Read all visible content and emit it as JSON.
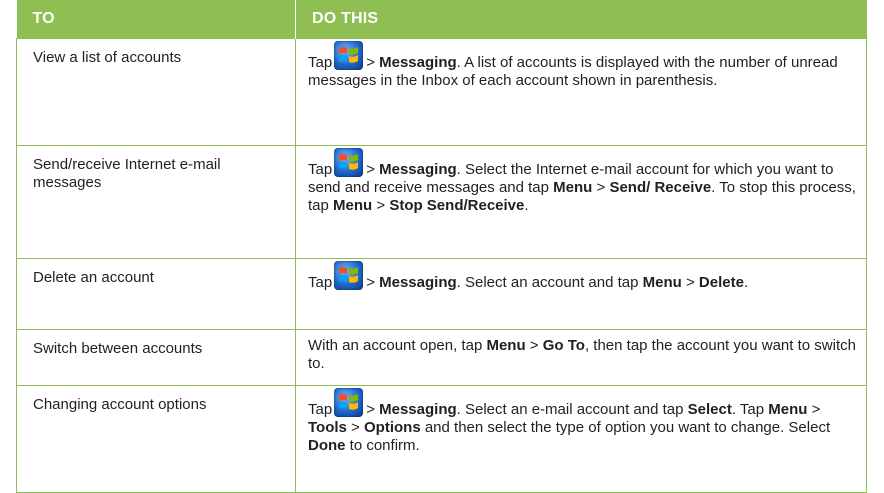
{
  "header": {
    "col1": "TO",
    "col2": "DO THIS"
  },
  "colors": {
    "header_bg": "#8fbe52",
    "header_text": "#ffffff",
    "border": "#8fbe52"
  },
  "icons": {
    "start": "windows-start-icon"
  },
  "rows": [
    {
      "task": "View a list of accounts",
      "action": {
        "tap": "Tap",
        "gt": ">",
        "messaging": "Messaging",
        "rest": ". A list of accounts is displayed with the number of unread messages in the Inbox of each account shown in parenthesis."
      }
    },
    {
      "task": "Send/receive Internet e-mail messages",
      "action": {
        "tap": "Tap",
        "gt": ">",
        "messaging": "Messaging",
        "t1": ". Select the Internet e-mail account for which you want to send and receive messages and tap ",
        "menu1": "Menu",
        "gt2": " > ",
        "send_receive": "Send/ Receive",
        "t2": ". To stop this process, tap ",
        "menu2": "Menu",
        "gt3": " > ",
        "stop": "Stop Send/Receive",
        "t3": "."
      }
    },
    {
      "task": "Delete an account",
      "action": {
        "tap": "Tap",
        "gt": ">",
        "messaging": "Messaging",
        "t1": ". Select an account and tap ",
        "menu": "Menu",
        "gt2": " > ",
        "delete": "Delete",
        "t2": "."
      }
    },
    {
      "task": "Switch between accounts",
      "action": {
        "t1": "With an account open, tap ",
        "menu": "Menu",
        "gt": " > ",
        "goto": "Go To",
        "t2": ", then tap the account you want to switch to."
      }
    },
    {
      "task": "Changing account options",
      "action": {
        "tap": "Tap",
        "gt": ">",
        "messaging": "Messaging",
        "t1": ". Select an e-mail account and tap ",
        "select": "Select",
        "t2": ". Tap ",
        "menu": "Menu",
        "gt2": " > ",
        "tools": "Tools",
        "gt3": " > ",
        "options": "Options",
        "t3": " and then select the type of option you want to change. Select ",
        "done": "Done",
        "t4": " to confirm."
      }
    }
  ]
}
